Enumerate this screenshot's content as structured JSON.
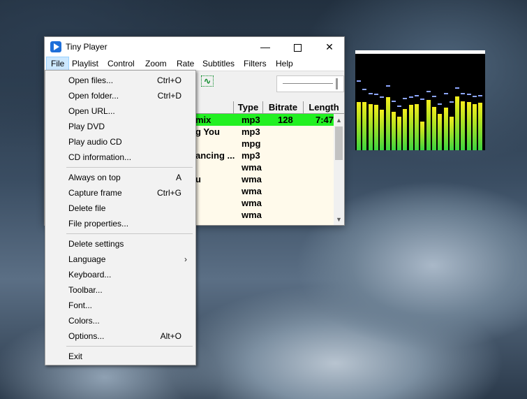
{
  "window": {
    "title": "Tiny Player",
    "controls": {
      "minimize": "—",
      "maximize": "",
      "close": "✕"
    }
  },
  "menubar": [
    "File",
    "Playlist",
    "Control",
    "Zoom",
    "Rate",
    "Subtitles",
    "Filters",
    "Help"
  ],
  "toolbar": {
    "wave_glyph": "∿"
  },
  "playlist": {
    "columns": [
      "Type",
      "Bitrate",
      "Length"
    ],
    "rows": [
      {
        "title": "mix",
        "type": "mp3",
        "bitrate": "128",
        "length": "7:47",
        "selected": true
      },
      {
        "title": "g You",
        "type": "mp3",
        "bitrate": "",
        "length": ""
      },
      {
        "title": "",
        "type": "mpg",
        "bitrate": "",
        "length": ""
      },
      {
        "title": "ancing ...",
        "type": "mp3",
        "bitrate": "",
        "length": ""
      },
      {
        "title": "",
        "type": "wma",
        "bitrate": "",
        "length": ""
      },
      {
        "title": "u",
        "type": "wma",
        "bitrate": "",
        "length": ""
      },
      {
        "title": "",
        "type": "wma",
        "bitrate": "",
        "length": ""
      },
      {
        "title": "",
        "type": "wma",
        "bitrate": "",
        "length": ""
      },
      {
        "title": "",
        "type": "wma",
        "bitrate": "",
        "length": ""
      }
    ],
    "scroll_up": "▲",
    "scroll_down": "▼"
  },
  "file_menu": {
    "groups": [
      [
        {
          "label": "Open files...",
          "shortcut": "Ctrl+O"
        },
        {
          "label": "Open folder...",
          "shortcut": "Ctrl+D"
        },
        {
          "label": "Open URL...",
          "shortcut": ""
        },
        {
          "label": "Play DVD",
          "shortcut": ""
        },
        {
          "label": "Play audio CD",
          "shortcut": ""
        },
        {
          "label": "CD information...",
          "shortcut": ""
        }
      ],
      [
        {
          "label": "Always on top",
          "shortcut": "A"
        },
        {
          "label": "Capture frame",
          "shortcut": "Ctrl+G"
        },
        {
          "label": "Delete file",
          "shortcut": ""
        },
        {
          "label": "File properties...",
          "shortcut": ""
        }
      ],
      [
        {
          "label": "Delete settings",
          "shortcut": ""
        },
        {
          "label": "Language",
          "shortcut": "",
          "submenu": "›"
        },
        {
          "label": "Keyboard...",
          "shortcut": ""
        },
        {
          "label": "Toolbar...",
          "shortcut": ""
        },
        {
          "label": "Font...",
          "shortcut": ""
        },
        {
          "label": "Colors...",
          "shortcut": ""
        },
        {
          "label": "Options...",
          "shortcut": "Alt+O"
        }
      ],
      [
        {
          "label": "Exit",
          "shortcut": ""
        }
      ]
    ]
  },
  "visualizer": {
    "levels": [
      0.5,
      0.5,
      0.48,
      0.47,
      0.42,
      0.55,
      0.4,
      0.35,
      0.43,
      0.47,
      0.48,
      0.3,
      0.52,
      0.45,
      0.38,
      0.44,
      0.35,
      0.56,
      0.51,
      0.5,
      0.48,
      0.49
    ],
    "peaks": [
      0.71,
      0.62,
      0.58,
      0.57,
      0.54,
      0.66,
      0.5,
      0.45,
      0.53,
      0.54,
      0.56,
      0.52,
      0.6,
      0.55,
      0.47,
      0.58,
      0.49,
      0.64,
      0.58,
      0.57,
      0.55,
      0.56
    ],
    "colors": {
      "top": "#f4ee1e",
      "bottom": "#3dd43f",
      "peak": "#8da6ff"
    }
  }
}
